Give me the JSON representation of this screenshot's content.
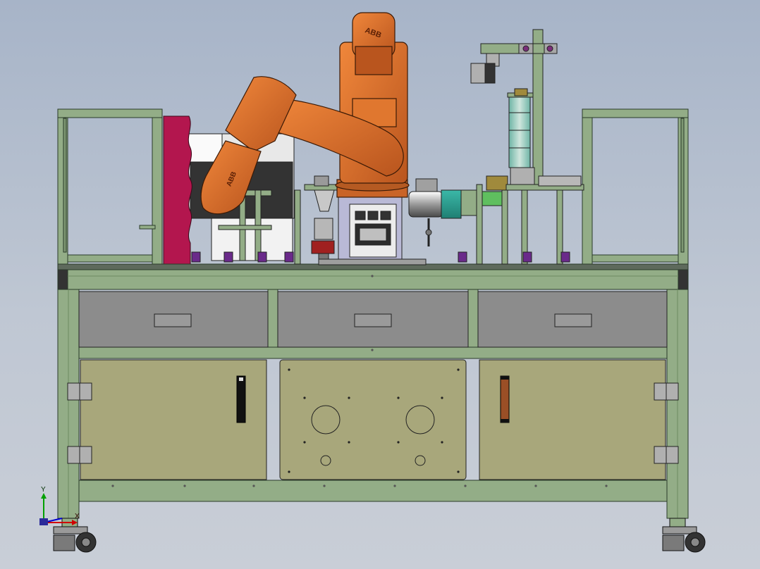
{
  "window": {
    "title": ""
  },
  "model": {
    "robot_brand": "ABB",
    "robot_brand_upper": "ABB",
    "robot_brand_lower": "ABB"
  },
  "triad": {
    "y_label": "Y",
    "x_label": "X"
  },
  "colors": {
    "background": "#b3bece",
    "frame": "#93ad87",
    "frame_edge": "#2a3a2a",
    "robot": "#d8702e",
    "panel": "#a8a77b",
    "drawer": "#8c8c8c",
    "magenta_plate": "#b3164e"
  }
}
